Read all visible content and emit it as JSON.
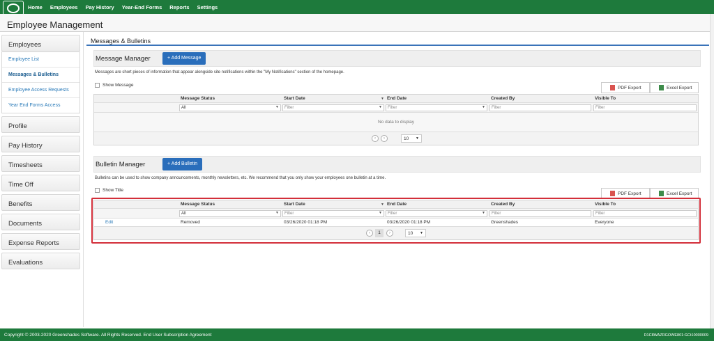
{
  "nav": {
    "items": [
      "Home",
      "Employees",
      "Pay History",
      "Year-End Forms",
      "Reports",
      "Settings"
    ]
  },
  "page": {
    "title": "Employee Management"
  },
  "sidebar": {
    "sections": [
      {
        "label": "Employees",
        "links": [
          "Employee List",
          "Messages & Bulletins",
          "Employee Access Requests",
          "Year End Forms Access"
        ],
        "active": "Messages & Bulletins"
      },
      {
        "label": "Profile"
      },
      {
        "label": "Pay History"
      },
      {
        "label": "Timesheets"
      },
      {
        "label": "Time Off"
      },
      {
        "label": "Benefits"
      },
      {
        "label": "Documents"
      },
      {
        "label": "Expense Reports"
      },
      {
        "label": "Evaluations"
      }
    ]
  },
  "main": {
    "section_title": "Messages & Bulletins",
    "message_manager": {
      "title": "Message Manager",
      "add_label": "+ Add Message",
      "description": "Messages are short pieces of information that appear alongside site notifications within the \"My Notifications\" section of the homepage.",
      "checkbox_label": "Show Message",
      "pdf_export": "PDF Export",
      "excel_export": "Excel Export",
      "columns": [
        "Message Status",
        "Start Date",
        "End Date",
        "Created By",
        "Visible To"
      ],
      "filter_status": "All",
      "filter_placeholder": "Filter",
      "empty_text": "No data to display",
      "page_size": "10"
    },
    "bulletin_manager": {
      "title": "Bulletin Manager",
      "add_label": "+ Add Bulletin",
      "description": "Bulletins can be used to show company announcements, monthly newsletters, etc. We recommend that you only show your employees one bulletin at a time.",
      "checkbox_label": "Show Title",
      "pdf_export": "PDF Export",
      "excel_export": "Excel Export",
      "columns": [
        "Message Status",
        "Start Date",
        "End Date",
        "Created By",
        "Visible To"
      ],
      "filter_status": "All",
      "filter_placeholder": "Filter",
      "rows": [
        {
          "action": "Edit",
          "status": "Removed",
          "start": "03/26/2020 01:18 PM",
          "end": "03/26/2020 01:18 PM",
          "created_by": "Greenshades",
          "visible_to": "Everyone"
        }
      ],
      "current_page": "1",
      "page_size": "10"
    }
  },
  "footer": {
    "copyright": "Copyright © 2003-2020 Greenshades Software. All Rights Reserved. End User Subscription Agreement",
    "code": "D1C8WAZRGOWE801:GCt10000009"
  },
  "colors": {
    "brand_green": "#1e7a3c",
    "accent_blue": "#2a6ebb",
    "highlight_red": "#d32f3a"
  }
}
